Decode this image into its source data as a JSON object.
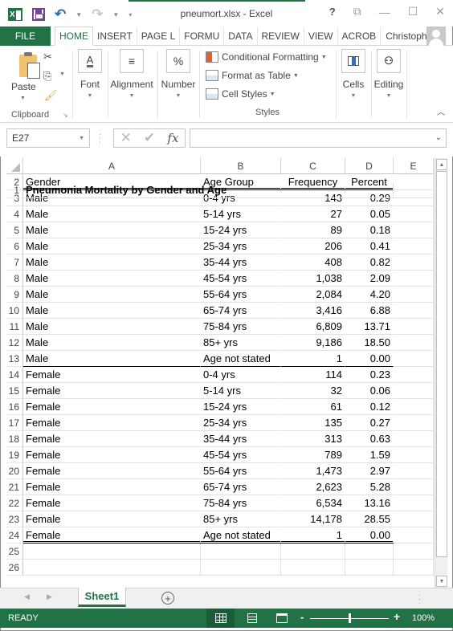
{
  "window": {
    "title": "pneumort.xlsx - Excel",
    "help": "?",
    "app_icon": "excel-icon",
    "qat": {
      "save_icon": "save-icon",
      "undo_icon": "undo-icon",
      "redo_icon": "redo-icon",
      "customize_icon": "customize-qat-icon"
    }
  },
  "ribbon_tabs": [
    {
      "label": "FILE"
    },
    {
      "label": "HOME",
      "active": true
    },
    {
      "label": "INSERT"
    },
    {
      "label": "PAGE L"
    },
    {
      "label": "FORMU"
    },
    {
      "label": "DATA"
    },
    {
      "label": "REVIEW"
    },
    {
      "label": "VIEW"
    },
    {
      "label": "ACROB"
    }
  ],
  "account": {
    "name": "Christoph...",
    "avatar_icon": "user-avatar-icon"
  },
  "ribbon": {
    "clipboard": {
      "paste": "Paste",
      "group_label": "Clipboard"
    },
    "font": "Font",
    "font_icon": "A",
    "alignment": "Alignment",
    "alignment_icon": "≡",
    "number": "Number",
    "number_icon": "%",
    "styles": {
      "conditional_formatting": "Conditional Formatting",
      "format_as_table": "Format as Table",
      "cell_styles": "Cell Styles",
      "group_label": "Styles"
    },
    "cells": "Cells",
    "editing": "Editing"
  },
  "formula_bar": {
    "name_box": "E27",
    "formula": "",
    "fx": "fx",
    "cancel": "✕",
    "enter": "✔"
  },
  "columns": [
    "A",
    "B",
    "C",
    "D",
    "E"
  ],
  "sheet": {
    "title": "Pneumonia Mortality by Gender and Age",
    "headers": [
      "Gender",
      "Age Group",
      "Frequency",
      "Percent"
    ],
    "rows": [
      [
        "Male",
        "0-4 yrs",
        "143",
        "0.29"
      ],
      [
        "Male",
        "5-14 yrs",
        "27",
        "0.05"
      ],
      [
        "Male",
        "15-24 yrs",
        "89",
        "0.18"
      ],
      [
        "Male",
        "25-34 yrs",
        "206",
        "0.41"
      ],
      [
        "Male",
        "35-44 yrs",
        "408",
        "0.82"
      ],
      [
        "Male",
        "45-54 yrs",
        "1,038",
        "2.09"
      ],
      [
        "Male",
        "55-64 yrs",
        "2,084",
        "4.20"
      ],
      [
        "Male",
        "65-74 yrs",
        "3,416",
        "6.88"
      ],
      [
        "Male",
        "75-84 yrs",
        "6,809",
        "13.71"
      ],
      [
        "Male",
        "85+ yrs",
        "9,186",
        "18.50"
      ],
      [
        "Male",
        "Age not stated",
        "1",
        "0.00"
      ],
      [
        "Female",
        "0-4 yrs",
        "114",
        "0.23"
      ],
      [
        "Female",
        "5-14 yrs",
        "32",
        "0.06"
      ],
      [
        "Female",
        "15-24 yrs",
        "61",
        "0.12"
      ],
      [
        "Female",
        "25-34 yrs",
        "135",
        "0.27"
      ],
      [
        "Female",
        "35-44 yrs",
        "313",
        "0.63"
      ],
      [
        "Female",
        "45-54 yrs",
        "789",
        "1.59"
      ],
      [
        "Female",
        "55-64 yrs",
        "1,473",
        "2.97"
      ],
      [
        "Female",
        "65-74 yrs",
        "2,623",
        "5.28"
      ],
      [
        "Female",
        "75-84 yrs",
        "6,534",
        "13.16"
      ],
      [
        "Female",
        "85+ yrs",
        "14,178",
        "28.55"
      ],
      [
        "Female",
        "Age not stated",
        "1",
        "0.00"
      ]
    ],
    "empty_row_numbers": [
      "25",
      "26"
    ]
  },
  "sheet_tabs": {
    "active": "Sheet1",
    "add_label": "+"
  },
  "status": {
    "text": "READY",
    "zoom": "100%",
    "zoom_fraction": 0.5
  }
}
